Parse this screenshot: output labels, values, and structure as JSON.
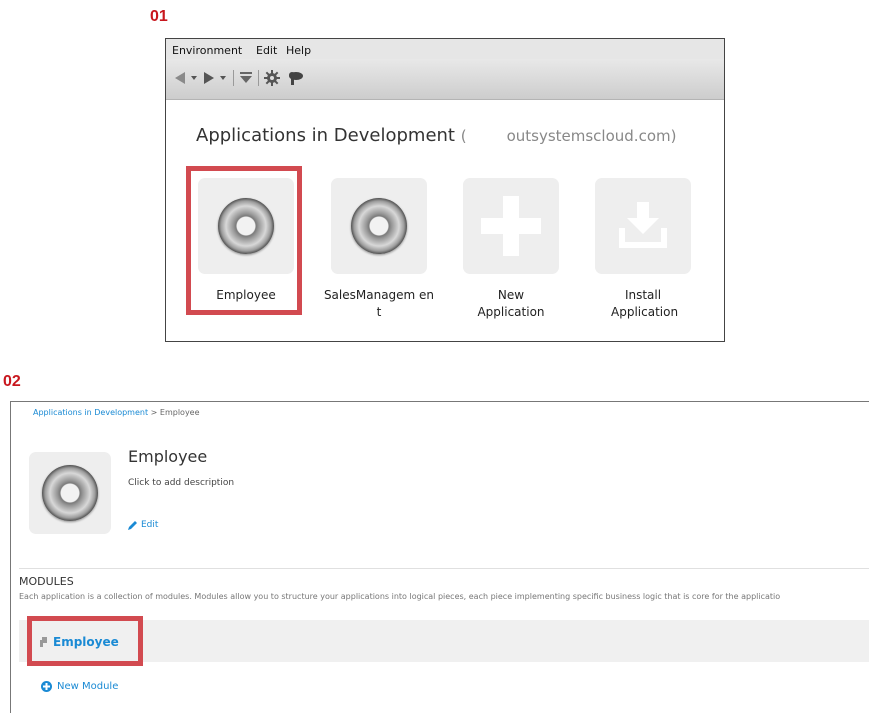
{
  "steps": {
    "step1": "01",
    "step2": "02"
  },
  "menu": {
    "environment": "Environment",
    "edit": "Edit",
    "help": "Help"
  },
  "toolbar_icons": [
    "back-arrow-icon",
    "dropdown-icon",
    "forward-arrow-icon",
    "dropdown-icon",
    "download-icon",
    "settings-gear-icon",
    "cloud-publish-icon"
  ],
  "apps_panel": {
    "heading": "Applications in Development",
    "paren_open": "(",
    "domain": "outsystemscloud.com)",
    "tiles": [
      {
        "label": "Employee",
        "icon": "app-disc-icon"
      },
      {
        "label": "SalesManagem ent",
        "icon": "app-disc-icon"
      },
      {
        "label": "New Application",
        "icon": "plus-icon"
      },
      {
        "label": "Install Application",
        "icon": "install-download-icon"
      }
    ]
  },
  "detail": {
    "breadcrumb_link": "Applications in Development",
    "breadcrumb_sep": " > ",
    "breadcrumb_current": "Employee",
    "app_title": "Employee",
    "app_description": "Click to add description",
    "edit_label": "Edit",
    "modules_title": "MODULES",
    "modules_description": "Each application is a collection of modules. Modules allow you to structure your applications into logical pieces, each piece implementing specific business logic that is core for the applicatio",
    "module_name": "Employee",
    "new_module_label": "New Module"
  },
  "colors": {
    "highlight": "#d24a50",
    "step_label": "#c8171e",
    "link": "#1a8ad4"
  }
}
